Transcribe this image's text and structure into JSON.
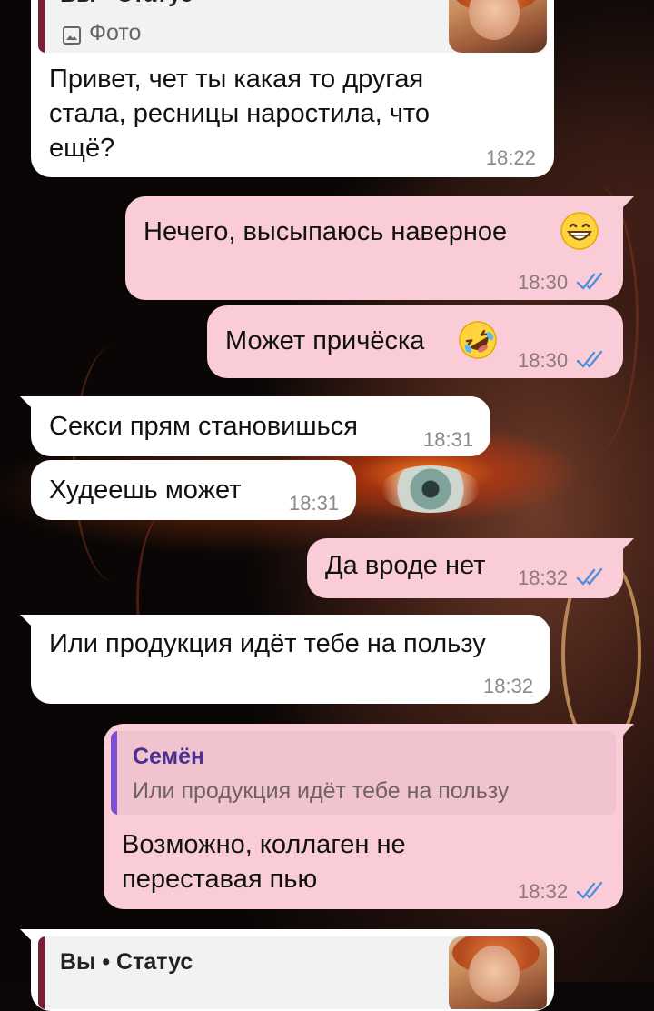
{
  "conversation": {
    "messages": [
      {
        "id": "m1",
        "direction": "incoming",
        "reply": {
          "name": "Вы • Статус",
          "media_label": "Фото"
        },
        "lines": [
          "Привет, чет ты какая то другая",
          "стала, ресницы наростила, что",
          "ещё?"
        ],
        "time": "18:22"
      },
      {
        "id": "m2",
        "direction": "outgoing",
        "text": "Нечего, высыпаюсь наверное",
        "emoji": "grinning-face",
        "time": "18:30",
        "status": "read"
      },
      {
        "id": "m3",
        "direction": "outgoing",
        "text": "Может причёска",
        "emoji": "rolling-on-floor-laughing",
        "time": "18:30",
        "status": "read"
      },
      {
        "id": "m4",
        "direction": "incoming",
        "text": "Секси прям становишься",
        "time": "18:31"
      },
      {
        "id": "m5",
        "direction": "incoming",
        "text": "Худеешь может",
        "time": "18:31"
      },
      {
        "id": "m6",
        "direction": "outgoing",
        "text": "Да вроде нет",
        "time": "18:32",
        "status": "read"
      },
      {
        "id": "m7",
        "direction": "incoming",
        "text": "Или продукция идёт тебе на пользу",
        "time": "18:32"
      },
      {
        "id": "m8",
        "direction": "outgoing",
        "reply": {
          "name": "Семён",
          "text": "Или продукция идёт тебе на пользу"
        },
        "lines": [
          "Возможно, коллаген не",
          "переставая пью"
        ],
        "time": "18:32",
        "status": "read"
      },
      {
        "id": "m9",
        "direction": "incoming",
        "reply": {
          "name": "Вы • Статус"
        }
      }
    ]
  },
  "colors": {
    "incoming_bubble": "#ffffff",
    "outgoing_bubble": "#f9ccd7",
    "read_ticks": "#4f8fdb",
    "status_reply_bar": "#7a1f35",
    "contact_reply_bar": "#7b4fd6",
    "contact_reply_name": "#4b2f93"
  }
}
